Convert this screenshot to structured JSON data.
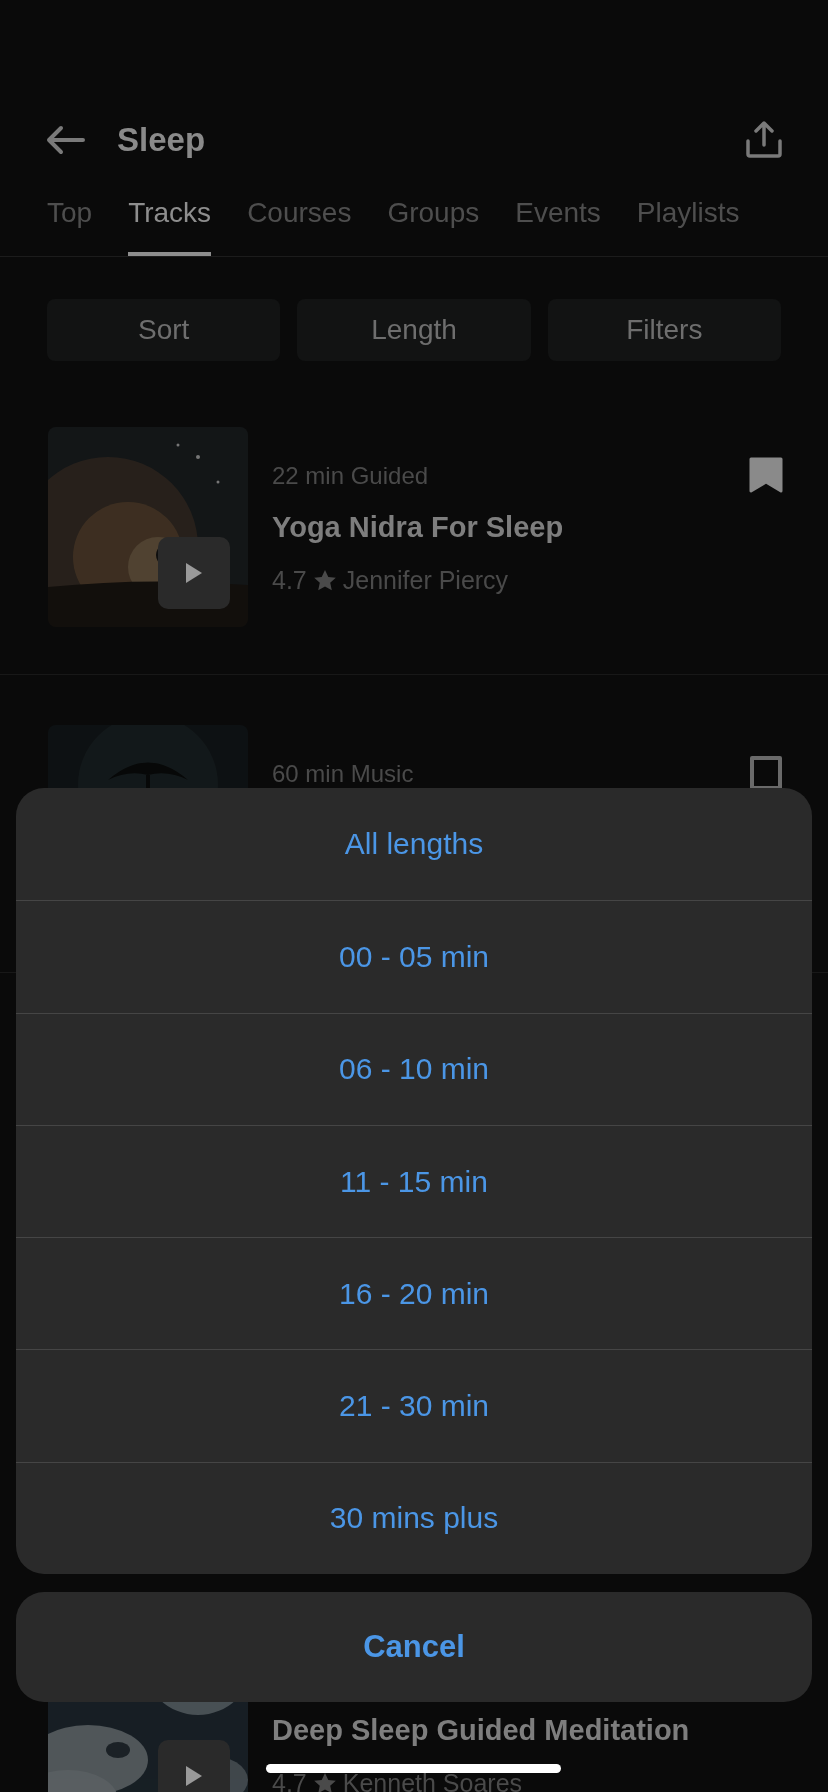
{
  "header": {
    "title": "Sleep"
  },
  "tabs": [
    {
      "label": "Top",
      "selected": false
    },
    {
      "label": "Tracks",
      "selected": true
    },
    {
      "label": "Courses",
      "selected": false
    },
    {
      "label": "Groups",
      "selected": false
    },
    {
      "label": "Events",
      "selected": false
    },
    {
      "label": "Playlists",
      "selected": false
    }
  ],
  "chips": [
    "Sort",
    "Length",
    "Filters"
  ],
  "tracks": [
    {
      "meta": "22 min Guided",
      "title": "Yoga Nidra For Sleep",
      "rating": "4.7",
      "author": "Jennifer Piercy",
      "saved": true
    },
    {
      "meta": "60 min Music",
      "saved": false
    }
  ],
  "last_track": {
    "title": "Deep Sleep Guided Meditation",
    "rating": "4.7",
    "author": "Kenneth Soares"
  },
  "action_sheet": {
    "options": [
      "All lengths",
      "00 - 05 min",
      "06 - 10 min",
      "11 - 15 min",
      "16 - 20 min",
      "21 - 30 min",
      "30 mins plus"
    ],
    "cancel": "Cancel"
  }
}
